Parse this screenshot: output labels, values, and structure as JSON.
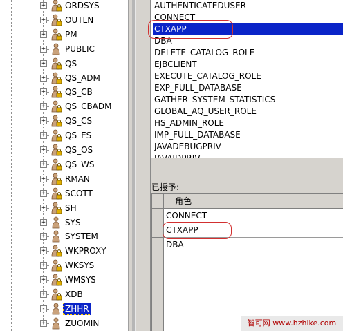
{
  "tree": {
    "nodes": [
      {
        "label": "ORDSYS",
        "expand": "+",
        "locked": true
      },
      {
        "label": "OUTLN",
        "expand": "+",
        "locked": true
      },
      {
        "label": "PM",
        "expand": "+",
        "locked": true
      },
      {
        "label": "PUBLIC",
        "expand": "+",
        "locked": false
      },
      {
        "label": "QS",
        "expand": "+",
        "locked": true
      },
      {
        "label": "QS_ADM",
        "expand": "+",
        "locked": true
      },
      {
        "label": "QS_CB",
        "expand": "+",
        "locked": true
      },
      {
        "label": "QS_CBADM",
        "expand": "+",
        "locked": true
      },
      {
        "label": "QS_CS",
        "expand": "+",
        "locked": true
      },
      {
        "label": "QS_ES",
        "expand": "+",
        "locked": true
      },
      {
        "label": "QS_OS",
        "expand": "+",
        "locked": true
      },
      {
        "label": "QS_WS",
        "expand": "+",
        "locked": true
      },
      {
        "label": "RMAN",
        "expand": "+",
        "locked": true
      },
      {
        "label": "SCOTT",
        "expand": "+",
        "locked": true
      },
      {
        "label": "SH",
        "expand": "+",
        "locked": true
      },
      {
        "label": "SYS",
        "expand": "+",
        "locked": false
      },
      {
        "label": "SYSTEM",
        "expand": "+",
        "locked": false
      },
      {
        "label": "WKPROXY",
        "expand": "+",
        "locked": true
      },
      {
        "label": "WKSYS",
        "expand": "+",
        "locked": true
      },
      {
        "label": "WMSYS",
        "expand": "+",
        "locked": true
      },
      {
        "label": "XDB",
        "expand": "+",
        "locked": true
      },
      {
        "label": "ZHHR",
        "expand": "-",
        "locked": false,
        "selected": true
      },
      {
        "label": "ZUOMIN",
        "expand": "+",
        "locked": false
      }
    ]
  },
  "role_list": {
    "items": [
      "AUTHENTICATEDUSER",
      "CONNECT",
      "CTXAPP",
      "DBA",
      "DELETE_CATALOG_ROLE",
      "EJBCLIENT",
      "EXECUTE_CATALOG_ROLE",
      "EXP_FULL_DATABASE",
      "GATHER_SYSTEM_STATISTICS",
      "GLOBAL_AQ_USER_ROLE",
      "HS_ADMIN_ROLE",
      "IMP_FULL_DATABASE",
      "JAVADEBUGPRIV",
      "JAVAIDPRIV"
    ],
    "selected_index": 2
  },
  "granted": {
    "label": "已授予:",
    "column_header": "角色",
    "rows": [
      "CONNECT",
      "CTXAPP",
      "DBA"
    ]
  },
  "watermark": "智可网 www.hzhike.com",
  "colors": {
    "selection": "#0a24c8",
    "highlight_oval": "#d23030",
    "panel": "#d6d3ce"
  }
}
